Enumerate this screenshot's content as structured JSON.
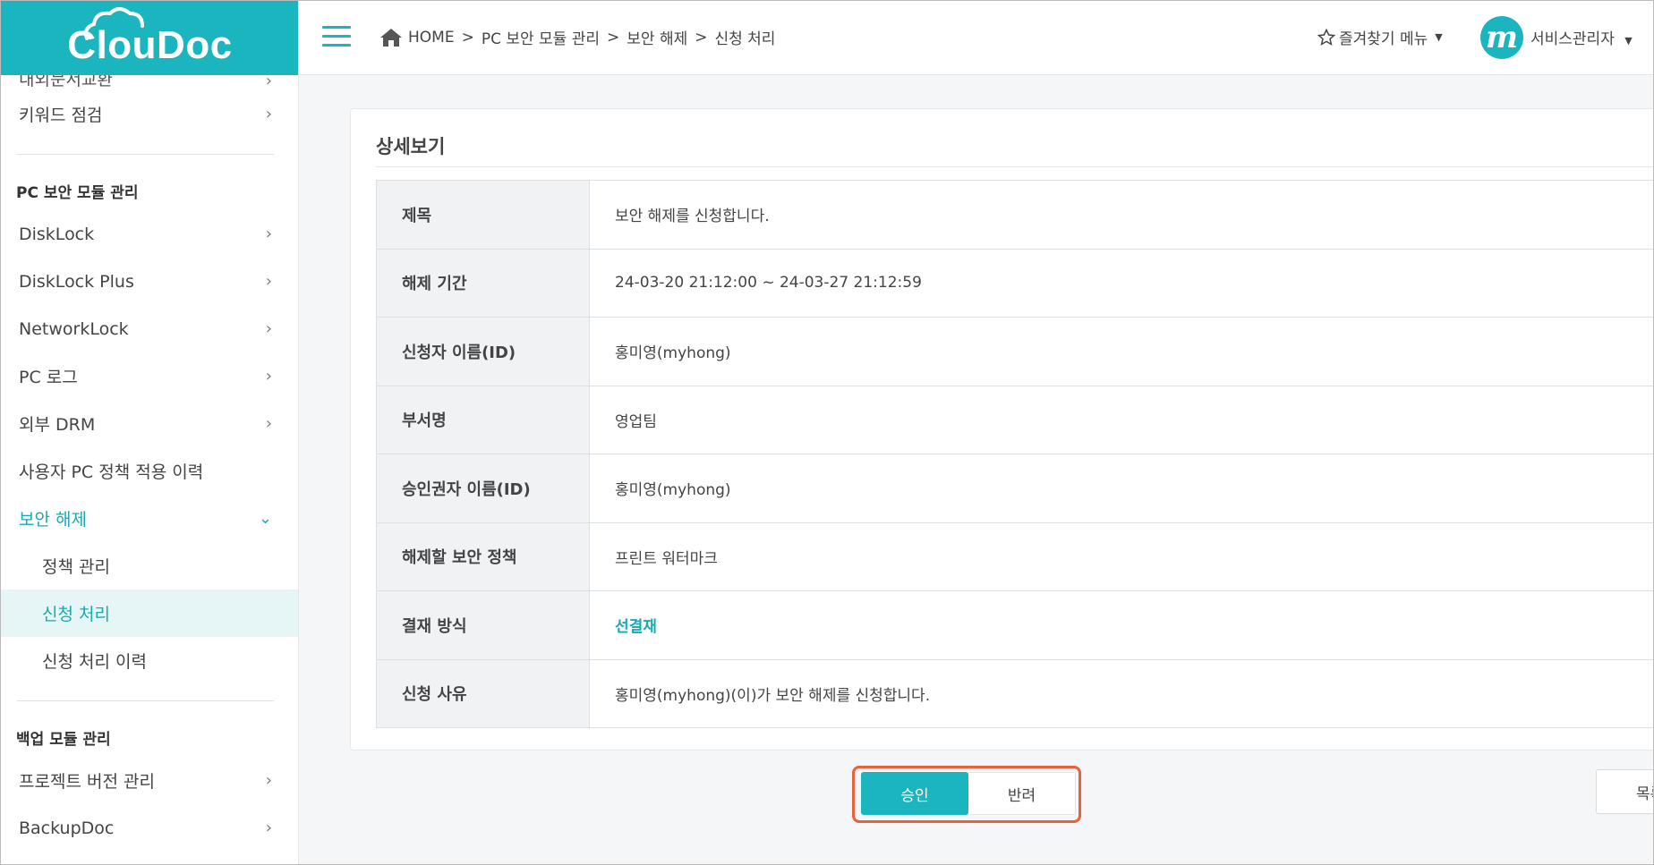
{
  "app": {
    "logo_text": "ClouDoc"
  },
  "colors": {
    "brand": "#1ab5bf",
    "accent_text": "#1aa8b2",
    "highlight_border": "#e8603c"
  },
  "sidebar": {
    "cut_item": "내외문서교환",
    "items_top": [
      {
        "label": "키워드 점검"
      }
    ],
    "section_pc": "PC 보안 모듈 관리",
    "items_pc": [
      {
        "label": "DiskLock"
      },
      {
        "label": "DiskLock Plus"
      },
      {
        "label": "NetworkLock"
      },
      {
        "label": "PC 로그"
      },
      {
        "label": "외부 DRM"
      },
      {
        "label": "사용자 PC 정책 적용 이력"
      }
    ],
    "active_group": "보안 해제",
    "sub_items": [
      {
        "label": "정책 관리"
      },
      {
        "label": "신청 처리"
      },
      {
        "label": "신청 처리 이력"
      }
    ],
    "section_backup": "백업 모듈 관리",
    "items_backup": [
      {
        "label": "프로젝트 버전 관리"
      },
      {
        "label": "BackupDoc"
      }
    ]
  },
  "header": {
    "breadcrumb": [
      "HOME",
      "PC 보안 모듈 관리",
      "보안 해제",
      "신청 처리"
    ],
    "separator": ">",
    "favorites": "즐겨찾기 메뉴",
    "avatar_letter": "m",
    "user_name": "서비스관리자"
  },
  "detail": {
    "title": "상세보기",
    "rows": [
      {
        "label": "제목",
        "value": "보안 해제를 신청합니다."
      },
      {
        "label": "해제 기간",
        "value": "24-03-20 21:12:00 ~ 24-03-27 21:12:59"
      },
      {
        "label": "신청자 이름(ID)",
        "value": "홍미영(myhong)"
      },
      {
        "label": "부서명",
        "value": "영업팀"
      },
      {
        "label": "승인권자 이름(ID)",
        "value": "홍미영(myhong)"
      },
      {
        "label": "해제할 보안 정책",
        "value": "프린트 워터마크"
      },
      {
        "label": "결재 방식",
        "value": "선결재"
      },
      {
        "label": "신청 사유",
        "value": "홍미영(myhong)(이)가 보안 해제를 신청합니다."
      }
    ]
  },
  "actions": {
    "approve": "승인",
    "reject": "반려",
    "list": "목록"
  }
}
